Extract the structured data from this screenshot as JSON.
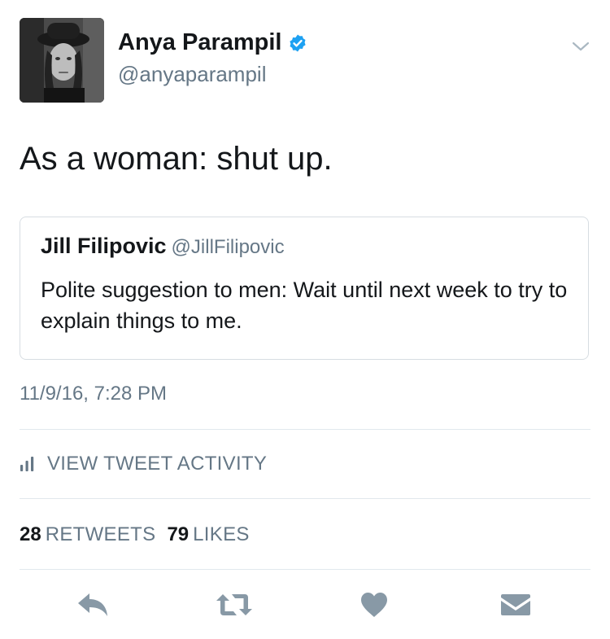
{
  "author": {
    "name": "Anya Parampil",
    "handle": "@anyaparampil",
    "verified": true
  },
  "tweet": {
    "text": "As a woman: shut up.",
    "timestamp": "11/9/16, 7:28 PM"
  },
  "quoted_tweet": {
    "name": "Jill Filipovic",
    "handle": "@JillFilipovic",
    "text": "Polite suggestion to men: Wait until next week to try to explain things to me."
  },
  "activity": {
    "label": "VIEW TWEET ACTIVITY"
  },
  "stats": {
    "retweets_count": "28",
    "retweets_label": "RETWEETS",
    "likes_count": "79",
    "likes_label": "LIKES"
  },
  "actions": [
    "reply-icon",
    "retweet-icon",
    "like-icon",
    "direct-message-icon"
  ],
  "colors": {
    "text": "#14171a",
    "secondary": "#657786",
    "verified": "#1da1f2",
    "action_icons": "#8899a6",
    "border": "#e1e8ed"
  }
}
